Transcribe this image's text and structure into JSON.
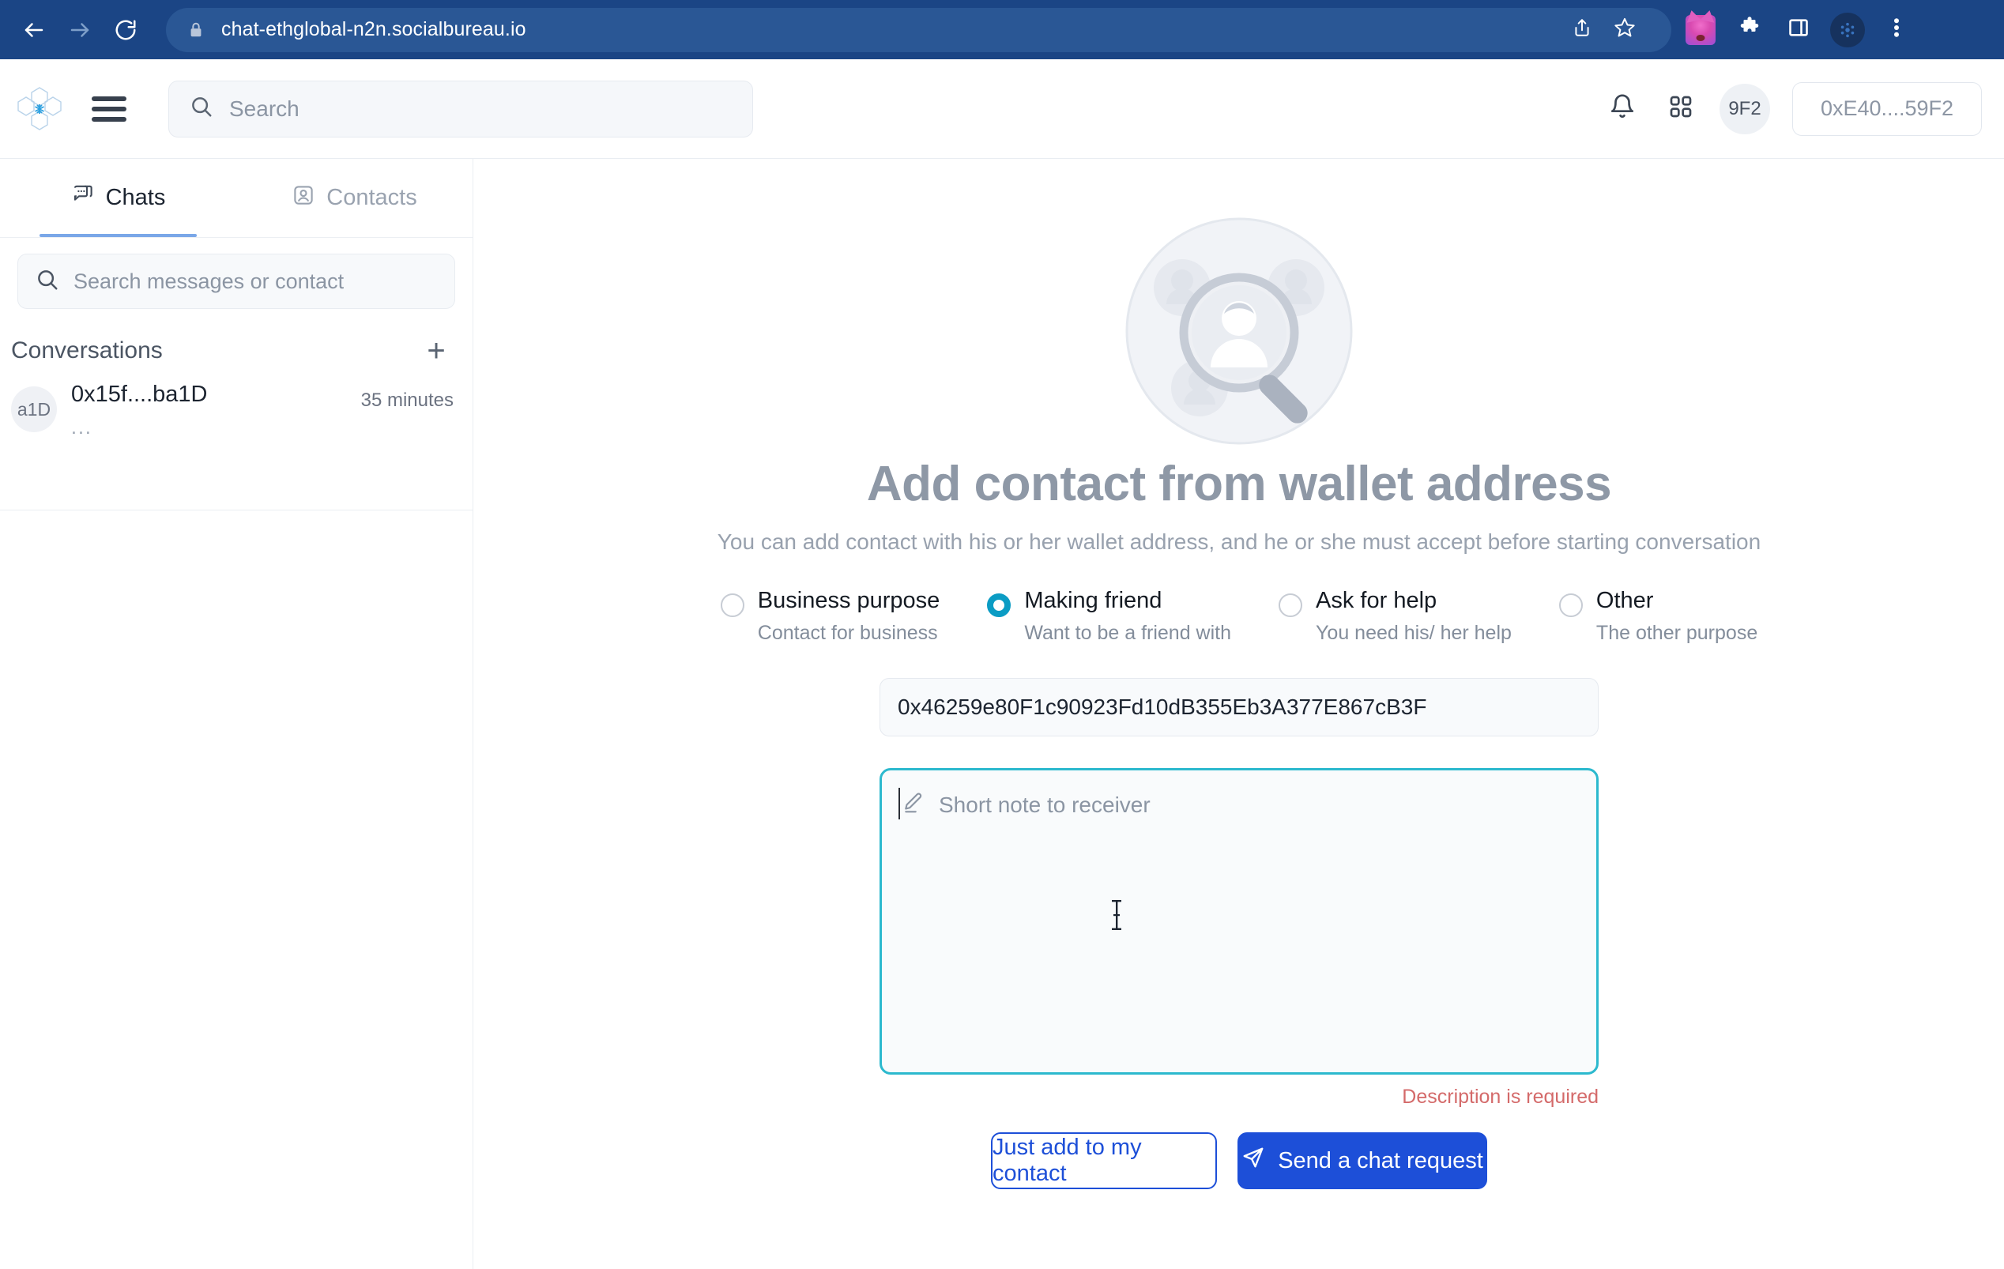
{
  "browser": {
    "url": "chat-ethglobal-n2n.socialbureau.io",
    "back_icon": "back-arrow-icon",
    "forward_icon": "forward-arrow-icon",
    "reload_icon": "reload-icon",
    "lock_icon": "lock-icon",
    "share_icon": "share-icon",
    "bookmark_icon": "star-icon",
    "metamask_icon": "metamask-fox-icon",
    "extensions_icon": "puzzle-piece-icon",
    "sidepanel_icon": "side-panel-icon",
    "profile_icon": "profile-avatar-icon",
    "menu_icon": "three-dot-menu-icon"
  },
  "app_header": {
    "logo_name": "socialbureau-logo",
    "menu_icon": "hamburger-menu-icon",
    "search_placeholder": "Search",
    "search_icon": "search-icon",
    "bell_icon": "notifications-bell-icon",
    "apps_icon": "apps-grid-icon",
    "account_badge": "9F2",
    "wallet_address": "0xE40....59F2"
  },
  "sidebar": {
    "tabs": [
      {
        "label": "Chats",
        "icon": "chat-bubbles-icon",
        "active": true
      },
      {
        "label": "Contacts",
        "icon": "contact-card-icon",
        "active": false
      }
    ],
    "search_placeholder": "Search messages or contact",
    "search_icon": "search-icon",
    "conversations_title": "Conversations",
    "add_label": "+",
    "conversations": [
      {
        "avatar": "a1D",
        "name": "0x15f....ba1D",
        "preview": "...",
        "time": "35 minutes"
      }
    ]
  },
  "main": {
    "illustration": "contact-search-illustration",
    "title": "Add contact from wallet address",
    "subtitle": "You can add contact with his or her wallet address, and he or she must accept before starting conversation",
    "purposes": [
      {
        "label": "Business purpose",
        "desc": "Contact for business",
        "selected": false
      },
      {
        "label": "Making friend",
        "desc": "Want to be a friend with",
        "selected": true
      },
      {
        "label": "Ask for help",
        "desc": "You need his/ her help",
        "selected": false
      },
      {
        "label": "Other",
        "desc": "The other purpose",
        "selected": false
      }
    ],
    "wallet_input_value": "0x46259e80F1c90923Fd10dB355Eb3A377E867cB3F",
    "note_placeholder": "Short note to receiver",
    "note_icon": "pencil-edit-icon",
    "note_value": "",
    "error_text": "Description is required",
    "secondary_button": "Just add to my contact",
    "primary_button": "Send a chat request",
    "primary_button_icon": "send-paper-plane-icon"
  },
  "colors": {
    "browser_chrome": "#1B4585",
    "accent_blue": "#1d4fd8",
    "focus_teal": "#2cb9ce",
    "radio_selected": "#0b9cc4",
    "error_red": "#d46a6a",
    "tab_underline": "#7aa7e8"
  }
}
